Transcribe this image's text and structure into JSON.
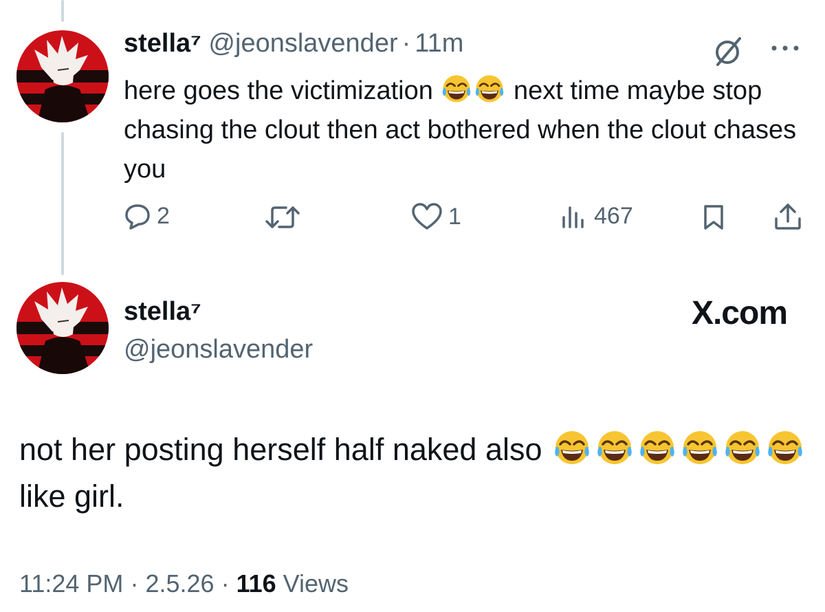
{
  "reply_tweet": {
    "display_name": "stella⁷",
    "handle": "@jeonslavender",
    "separator": "·",
    "time": "11m",
    "text_part1": "here goes the victimization",
    "text_part2": "next time maybe stop chasing the clout then act bothered when the clout chases you",
    "icons": [
      "grok-icon",
      "more-icon"
    ],
    "actions": {
      "replies": "2",
      "retweets": "",
      "likes": "1",
      "views": "467"
    }
  },
  "main_tweet": {
    "display_name": "stella⁷",
    "handle": "@jeonslavender",
    "watermark": "X.com",
    "text_part1": "not her posting herself half naked also",
    "text_part2": "like girl.",
    "timestamp": {
      "time": "11:24 PM",
      "date": "2.5.26",
      "separator": "·",
      "views_count": "116",
      "views_label": "Views"
    }
  },
  "colors": {
    "text": "#0f1419",
    "secondary": "#536471",
    "thread_line": "#cfd9de",
    "avatar_red": "#d0131b"
  }
}
